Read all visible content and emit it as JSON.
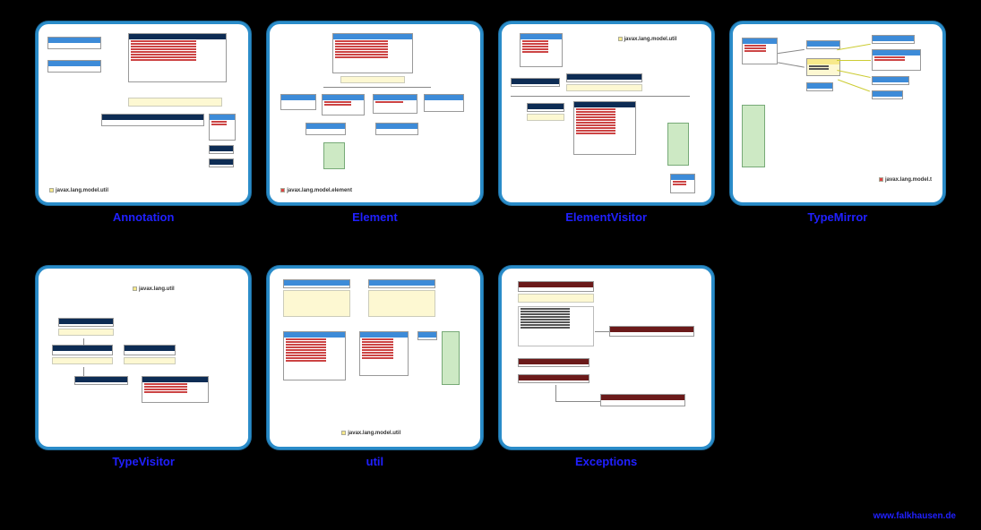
{
  "thumbnails": [
    {
      "label": "Annotation",
      "package": "javax.lang.model.util"
    },
    {
      "label": "Element",
      "package": "javax.lang.model.element"
    },
    {
      "label": "ElementVisitor",
      "package": "javax.lang.model.util"
    },
    {
      "label": "TypeMirror",
      "package": "javax.lang.model.t"
    },
    {
      "label": "TypeVisitor",
      "package": ""
    },
    {
      "label": "util",
      "package": "javax.lang.model.util"
    },
    {
      "label": "Exceptions",
      "package": ""
    }
  ],
  "footer": "www.falkhausen.de"
}
